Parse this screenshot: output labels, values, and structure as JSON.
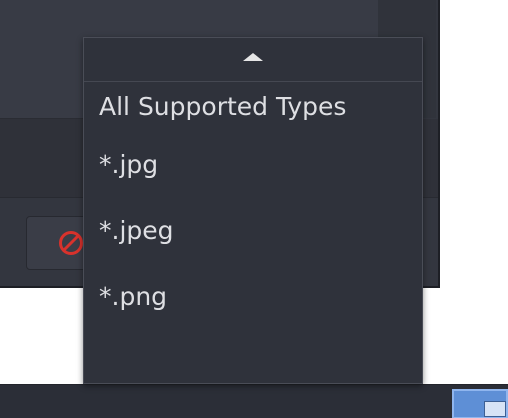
{
  "file_type_menu": {
    "scroll_up_icon": "triangle-up-icon",
    "items": [
      {
        "label": "All Supported Types"
      },
      {
        "label": "*.jpg"
      },
      {
        "label": "*.jpeg"
      },
      {
        "label": "*.png"
      }
    ]
  },
  "dialog": {
    "cancel_button": {
      "icon": "cancel-icon",
      "icon_color": "#d8322c"
    }
  },
  "taskbar": {
    "tray_item": {
      "icon": "window-icon",
      "accent_color": "#5e8fd6"
    }
  }
}
